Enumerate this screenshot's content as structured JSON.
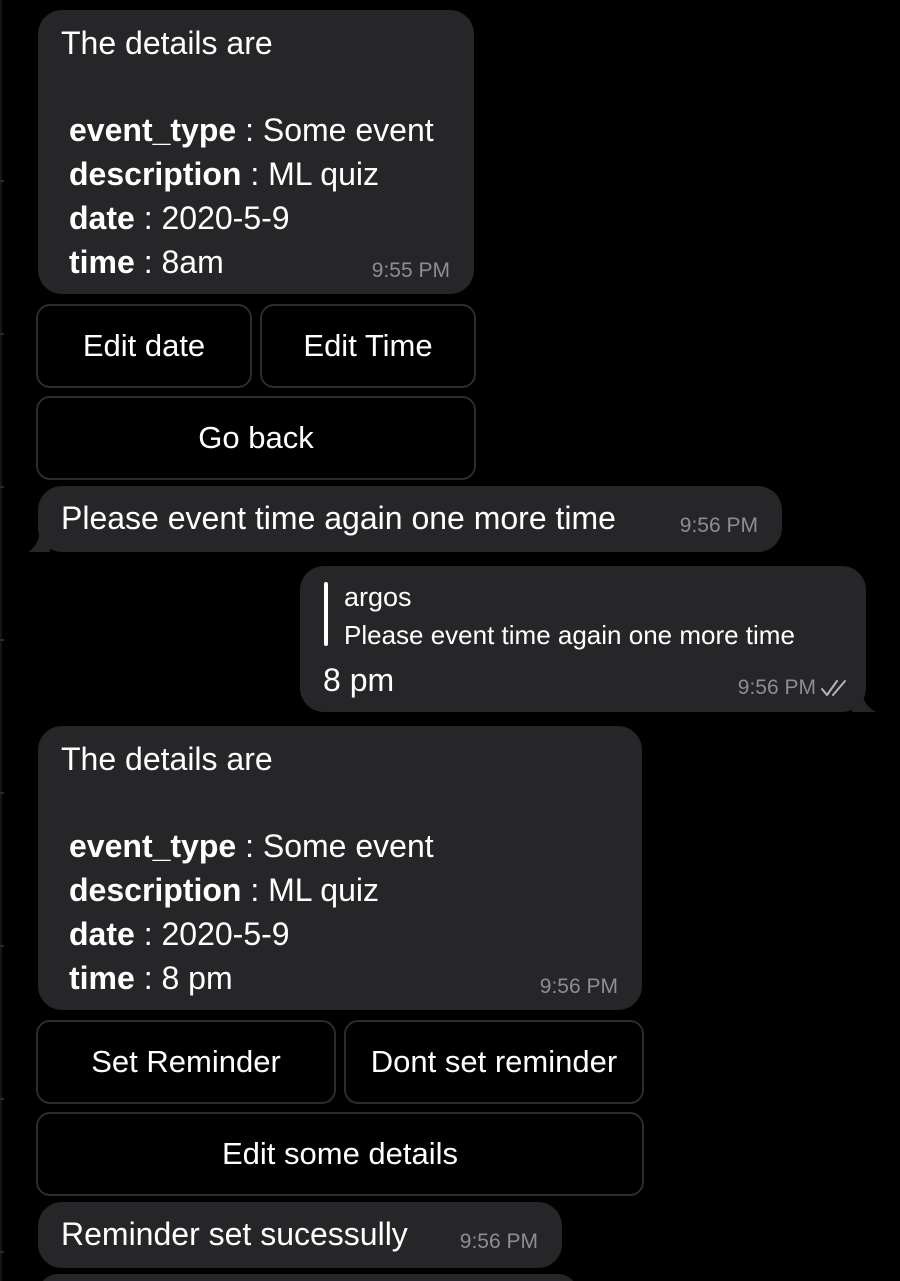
{
  "messages": {
    "details_1": {
      "heading": "The details are",
      "rows": [
        {
          "key": "event_type",
          "sep": " : ",
          "value": "Some event"
        },
        {
          "key": "description",
          "sep": " : ",
          "value": "ML quiz"
        },
        {
          "key": "date",
          "sep": " : ",
          "value": "2020-5-9"
        },
        {
          "key": "time",
          "sep": " : ",
          "value": "8am"
        }
      ],
      "time": "9:55 PM"
    },
    "keyboard_1": {
      "edit_date": "Edit date",
      "edit_time": "Edit Time",
      "go_back": "Go back"
    },
    "prompt": {
      "text": "Please event time again one more time",
      "time": "9:56 PM"
    },
    "reply": {
      "quoted_author": "argos",
      "quoted_text": "Please event time again one more time",
      "text": "8 pm",
      "time": "9:56 PM",
      "status_icon": "double-check-icon"
    },
    "details_2": {
      "heading": "The details are",
      "rows": [
        {
          "key": "event_type",
          "sep": " : ",
          "value": "Some event"
        },
        {
          "key": "description",
          "sep": " : ",
          "value": "ML quiz"
        },
        {
          "key": "date",
          "sep": " : ",
          "value": "2020-5-9"
        },
        {
          "key": "time",
          "sep": " : ",
          "value": "8 pm"
        }
      ],
      "time": "9:56 PM"
    },
    "keyboard_2": {
      "set_reminder": "Set Reminder",
      "dont_set_reminder": "Dont set reminder",
      "edit_some_details": "Edit some details"
    },
    "confirmation": {
      "text": "Reminder set sucessully",
      "time": "9:56 PM"
    }
  },
  "colors": {
    "background": "#000000",
    "bubble": "#262628",
    "timestamp": "#8d8d92",
    "button_border": "#2c2c2e"
  }
}
